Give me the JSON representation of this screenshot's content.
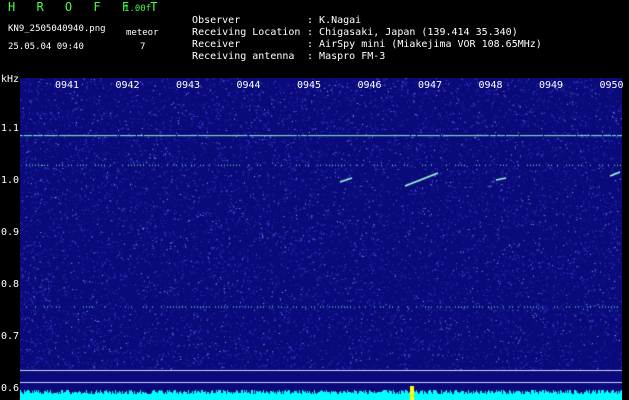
{
  "header": {
    "brand": "H R O F F T",
    "version": "1.00f",
    "filename": "KN9_2505040940.png",
    "datetime": "25.05.04 09:40",
    "meteor_label": "meteor",
    "meteor_count": "7"
  },
  "info": [
    {
      "key": "Observer",
      "sep": ":",
      "value": "K.Nagai"
    },
    {
      "key": "Receiving Location",
      "sep": ":",
      "value": "Chigasaki, Japan (139.414 35.340)"
    },
    {
      "key": "Receiver",
      "sep": ":",
      "value": "AirSpy mini (Miakejima VOR 108.65MHz)"
    },
    {
      "key": "Receiving antenna",
      "sep": ":",
      "value": "Maspro FM-3"
    }
  ],
  "plot": {
    "y_unit": "kHz",
    "time_labels": [
      "0941",
      "0942",
      "0943",
      "0944",
      "0945",
      "0946",
      "0947",
      "0948",
      "0949",
      "0950"
    ],
    "freq_labels": [
      "1.1",
      "1.0",
      "0.9",
      "0.8",
      "0.7",
      "0.6"
    ],
    "freq_values": [
      1.1,
      1.0,
      0.9,
      0.8,
      0.7,
      0.6
    ],
    "freq_range": [
      0.58,
      1.2
    ],
    "time_range_min": [
      0,
      10
    ],
    "colors": {
      "background": "#0a0a7a",
      "noise": "#3c4cff",
      "carrier": "#7fffc8",
      "baseline": "#00ffff"
    },
    "carrier_freqs": [
      1.09,
      1.033,
      0.76
    ]
  }
}
